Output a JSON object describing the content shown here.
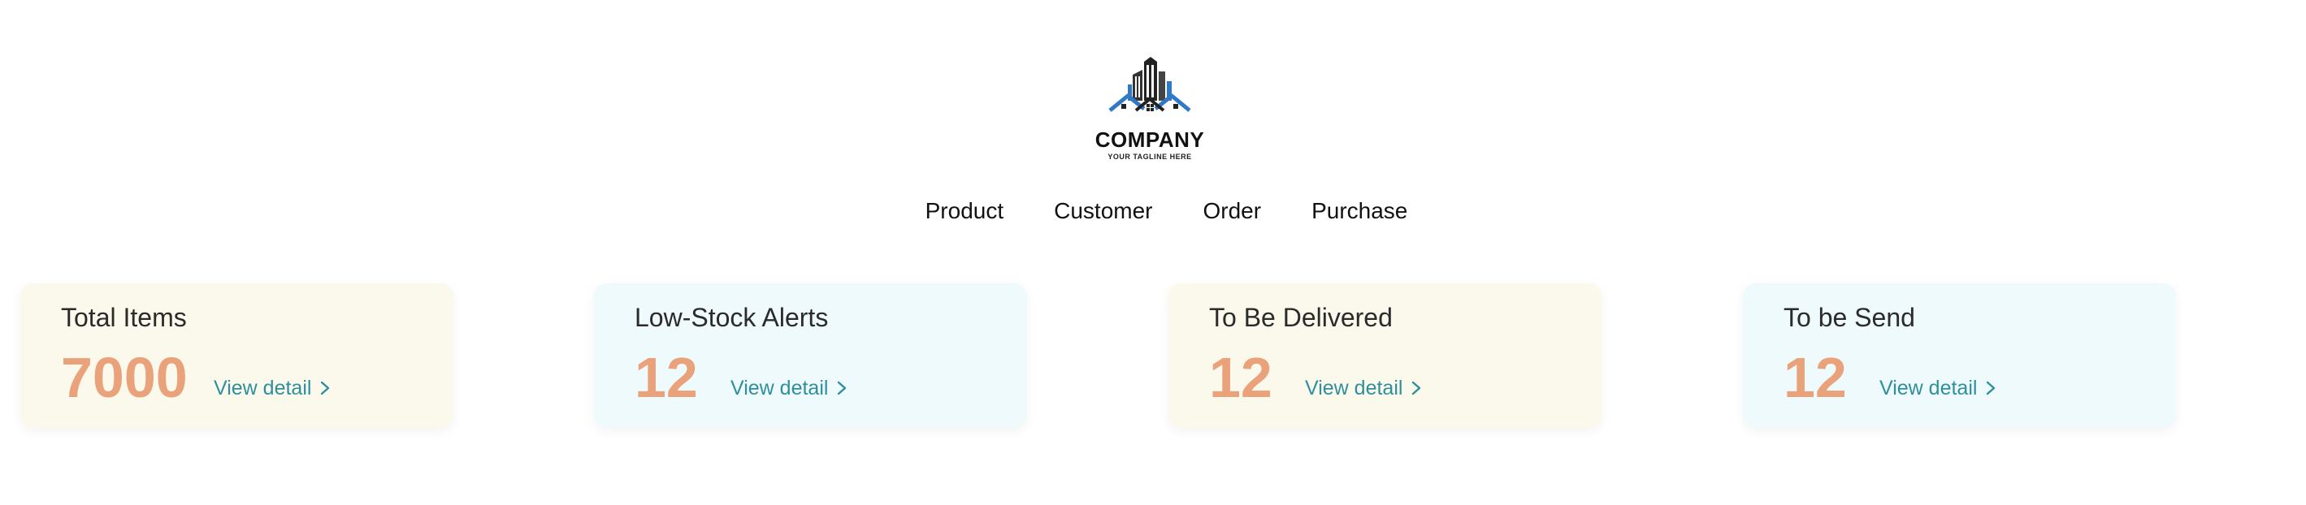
{
  "logo": {
    "name": "COMPANY",
    "tagline": "YOUR TAGLINE HERE",
    "colors": {
      "dark": "#222222",
      "blue": "#2f79c7"
    }
  },
  "nav": {
    "items": [
      "Product",
      "Customer",
      "Order",
      "Purchase"
    ]
  },
  "cards": [
    {
      "title": "Total Items",
      "value": "7000",
      "link": "View detail",
      "theme": "cream"
    },
    {
      "title": "Low-Stock Alerts",
      "value": "12",
      "link": "View detail",
      "theme": "ice"
    },
    {
      "title": "To Be Delivered",
      "value": "12",
      "link": "View detail",
      "theme": "cream"
    },
    {
      "title": "To be Send",
      "value": "12",
      "link": "View detail",
      "theme": "ice"
    }
  ],
  "colors": {
    "card_cream": "#fbf8ec",
    "card_ice": "#eefafc",
    "value_orange": "#e9a27a",
    "link_teal": "#2f8f9d"
  },
  "icons": {
    "link_arrow": "chevron-right-icon"
  }
}
